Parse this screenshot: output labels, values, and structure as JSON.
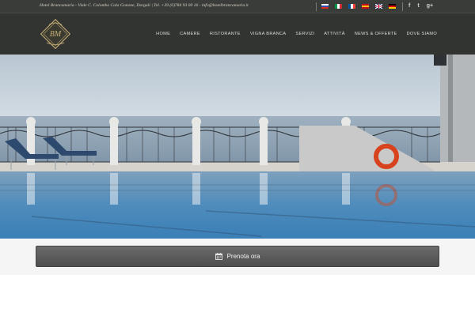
{
  "topbar": {
    "info_text": "Hotel Brancamaria - Viale C. Colombo Cala Gonone, Dorgali | Tel. +39 (0)784 93 00 16 - info@hotelbrancamaria.it",
    "flags": [
      {
        "name": "flag-russian",
        "colors": [
          "#ffffff",
          "#2b4fb5",
          "#d52b1e"
        ]
      },
      {
        "name": "flag-italian",
        "colors": [
          "#009246",
          "#ffffff",
          "#ce2b37"
        ]
      },
      {
        "name": "flag-french",
        "colors": [
          "#0055a4",
          "#ffffff",
          "#ef4135"
        ]
      },
      {
        "name": "flag-spanish",
        "colors": [
          "#c60b1e",
          "#ffc400",
          "#c60b1e"
        ]
      },
      {
        "name": "flag-english",
        "colors": [
          "#012169",
          "#ffffff",
          "#c8102e"
        ]
      },
      {
        "name": "flag-german",
        "colors": [
          "#000000",
          "#dd0000",
          "#ffce00"
        ]
      }
    ],
    "social": [
      {
        "name": "facebook-icon",
        "glyph": "f"
      },
      {
        "name": "twitter-icon",
        "glyph": "t"
      },
      {
        "name": "google-plus-icon",
        "glyph": "g+"
      }
    ]
  },
  "header": {
    "logo_icon": "hotel-logo-monogram",
    "logo_colors": {
      "frame": "#c9b27a",
      "fill": "#3a3a30"
    },
    "nav": [
      {
        "key": "home",
        "label": "HOME"
      },
      {
        "key": "camere",
        "label": "CAMERE"
      },
      {
        "key": "ristorante",
        "label": "RISTORANTE"
      },
      {
        "key": "vigna-branca",
        "label": "VIGNA BRANCA"
      },
      {
        "key": "servizi",
        "label": "SERVIZI"
      },
      {
        "key": "attivita",
        "label": "ATTIVITÀ"
      },
      {
        "key": "news",
        "label": "NEWS & OFFERTE"
      },
      {
        "key": "dove-siamo",
        "label": "DOVE SIAMO"
      }
    ]
  },
  "hero": {
    "icon": "pool-sea-view-photo"
  },
  "booking": {
    "icon": "calendar-icon",
    "label": "Prenota ora"
  },
  "colors": {
    "topbar_bg": "#3a3c3a",
    "header_bg": "#323432",
    "button_bg": "#5c5c5c"
  }
}
